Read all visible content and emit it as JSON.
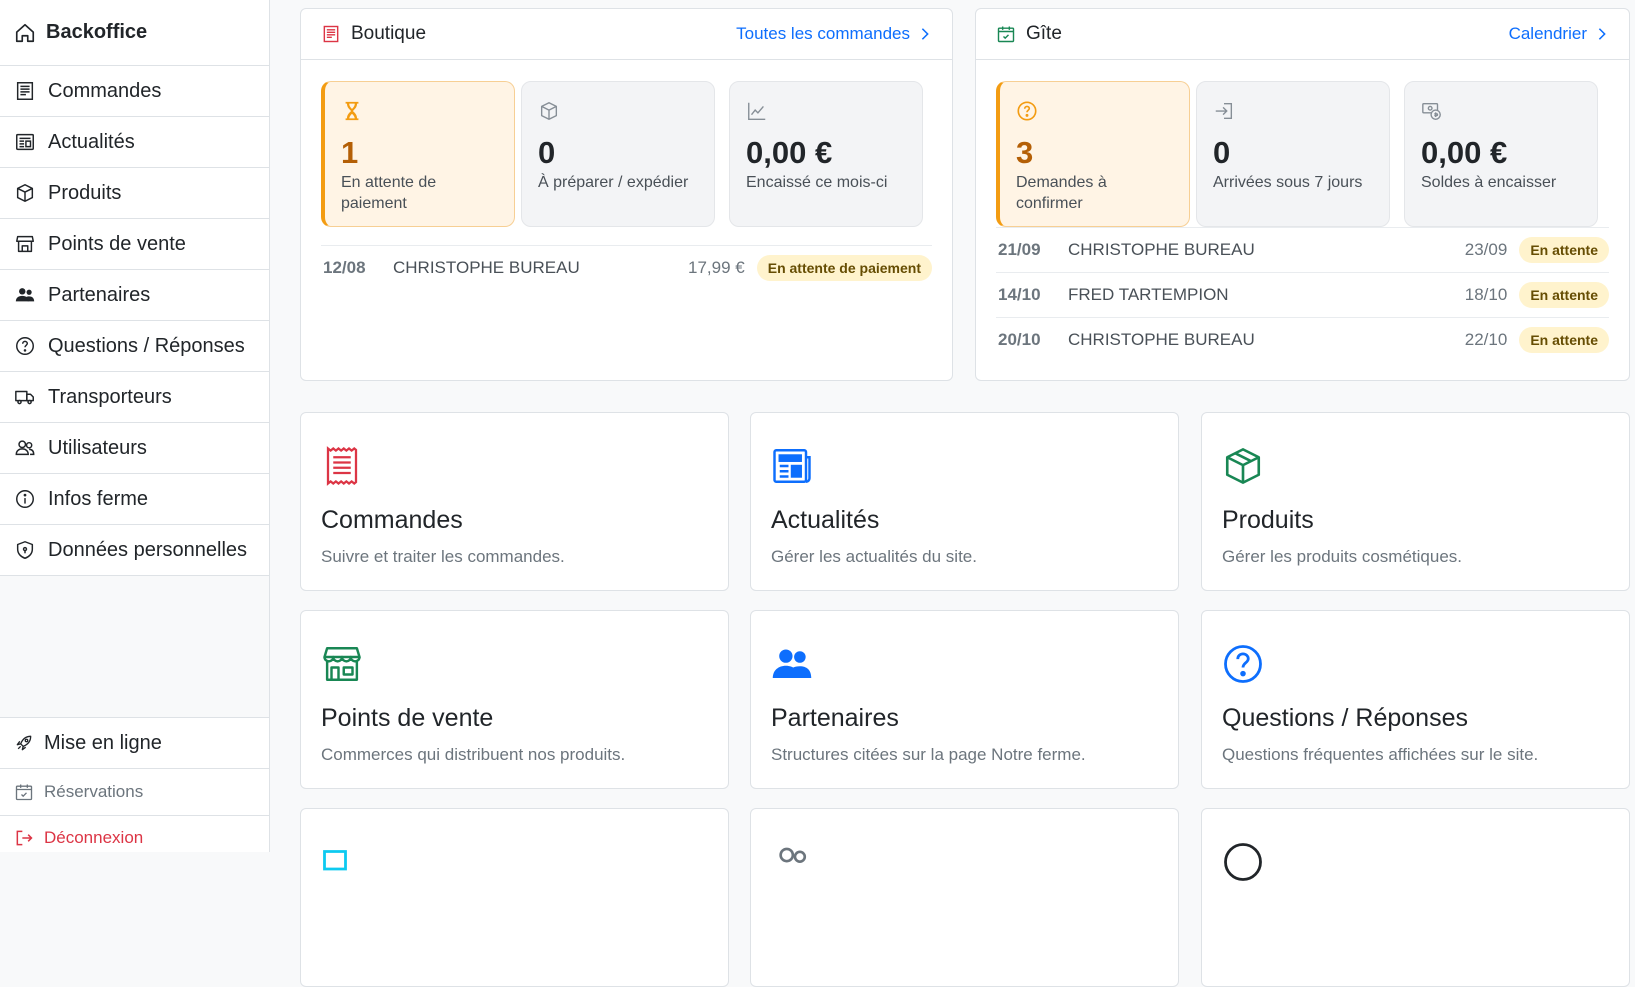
{
  "sidebar": {
    "brand": "Backoffice",
    "items": [
      {
        "label": "Commandes",
        "icon": "receipt-icon"
      },
      {
        "label": "Actualités",
        "icon": "newspaper-icon"
      },
      {
        "label": "Produits",
        "icon": "box-icon"
      },
      {
        "label": "Points de vente",
        "icon": "shop-icon"
      },
      {
        "label": "Partenaires",
        "icon": "people-icon"
      },
      {
        "label": "Questions / Réponses",
        "icon": "question-circle-icon"
      },
      {
        "label": "Transporteurs",
        "icon": "truck-icon"
      },
      {
        "label": "Utilisateurs",
        "icon": "users-icon"
      },
      {
        "label": "Infos ferme",
        "icon": "info-circle-icon"
      },
      {
        "label": "Données personnelles",
        "icon": "shield-icon"
      }
    ],
    "bottom": {
      "publish": "Mise en ligne",
      "reservations": "Réservations",
      "logout": "Déconnexion"
    }
  },
  "boutique": {
    "title": "Boutique",
    "link": "Toutes les commandes",
    "stats": [
      {
        "value": "1",
        "label": "En attente de paiement",
        "icon": "hourglass-icon"
      },
      {
        "value": "0",
        "label": "À préparer / expédier",
        "icon": "box-icon"
      },
      {
        "value": "0,00 €",
        "label": "Encaissé ce mois-ci",
        "icon": "chart-icon"
      }
    ],
    "rows": [
      {
        "date": "12/08",
        "name": "CHRISTOPHE BUREAU",
        "amount": "17,99 €",
        "status": "En attente de paiement"
      }
    ]
  },
  "gite": {
    "title": "Gîte",
    "link": "Calendrier",
    "stats": [
      {
        "value": "3",
        "label": "Demandes à confirmer",
        "icon": "question-circle-icon"
      },
      {
        "value": "0",
        "label": "Arrivées sous 7 jours",
        "icon": "login-icon"
      },
      {
        "value": "0,00 €",
        "label": "Soldes à encaisser",
        "icon": "cash-icon"
      }
    ],
    "rows": [
      {
        "date": "21/09",
        "name": "CHRISTOPHE BUREAU",
        "end": "23/09",
        "status": "En attente"
      },
      {
        "date": "14/10",
        "name": "FRED TARTEMPION",
        "end": "18/10",
        "status": "En attente"
      },
      {
        "date": "20/10",
        "name": "CHRISTOPHE BUREAU",
        "end": "22/10",
        "status": "En attente"
      }
    ]
  },
  "cards": [
    {
      "title": "Commandes",
      "desc": "Suivre et traiter les commandes.",
      "icon": "receipt-icon",
      "color": "#dc3545"
    },
    {
      "title": "Actualités",
      "desc": "Gérer les actualités du site.",
      "icon": "newspaper-icon",
      "color": "#0d6efd"
    },
    {
      "title": "Produits",
      "desc": "Gérer les produits cosmétiques.",
      "icon": "box-icon",
      "color": "#198754"
    },
    {
      "title": "Points de vente",
      "desc": "Commerces qui distribuent nos produits.",
      "icon": "shop-icon",
      "color": "#198754"
    },
    {
      "title": "Partenaires",
      "desc": "Structures citées sur la page Notre ferme.",
      "icon": "people-icon",
      "color": "#0d6efd"
    },
    {
      "title": "Questions / Réponses",
      "desc": "Questions fréquentes affichées sur le site.",
      "icon": "question-circle-icon",
      "color": "#0d6efd"
    }
  ],
  "colors": {
    "primary": "#0d6efd",
    "danger": "#dc3545",
    "success": "#198754",
    "warning": "#f39c12",
    "info": "#0dcaf0"
  }
}
